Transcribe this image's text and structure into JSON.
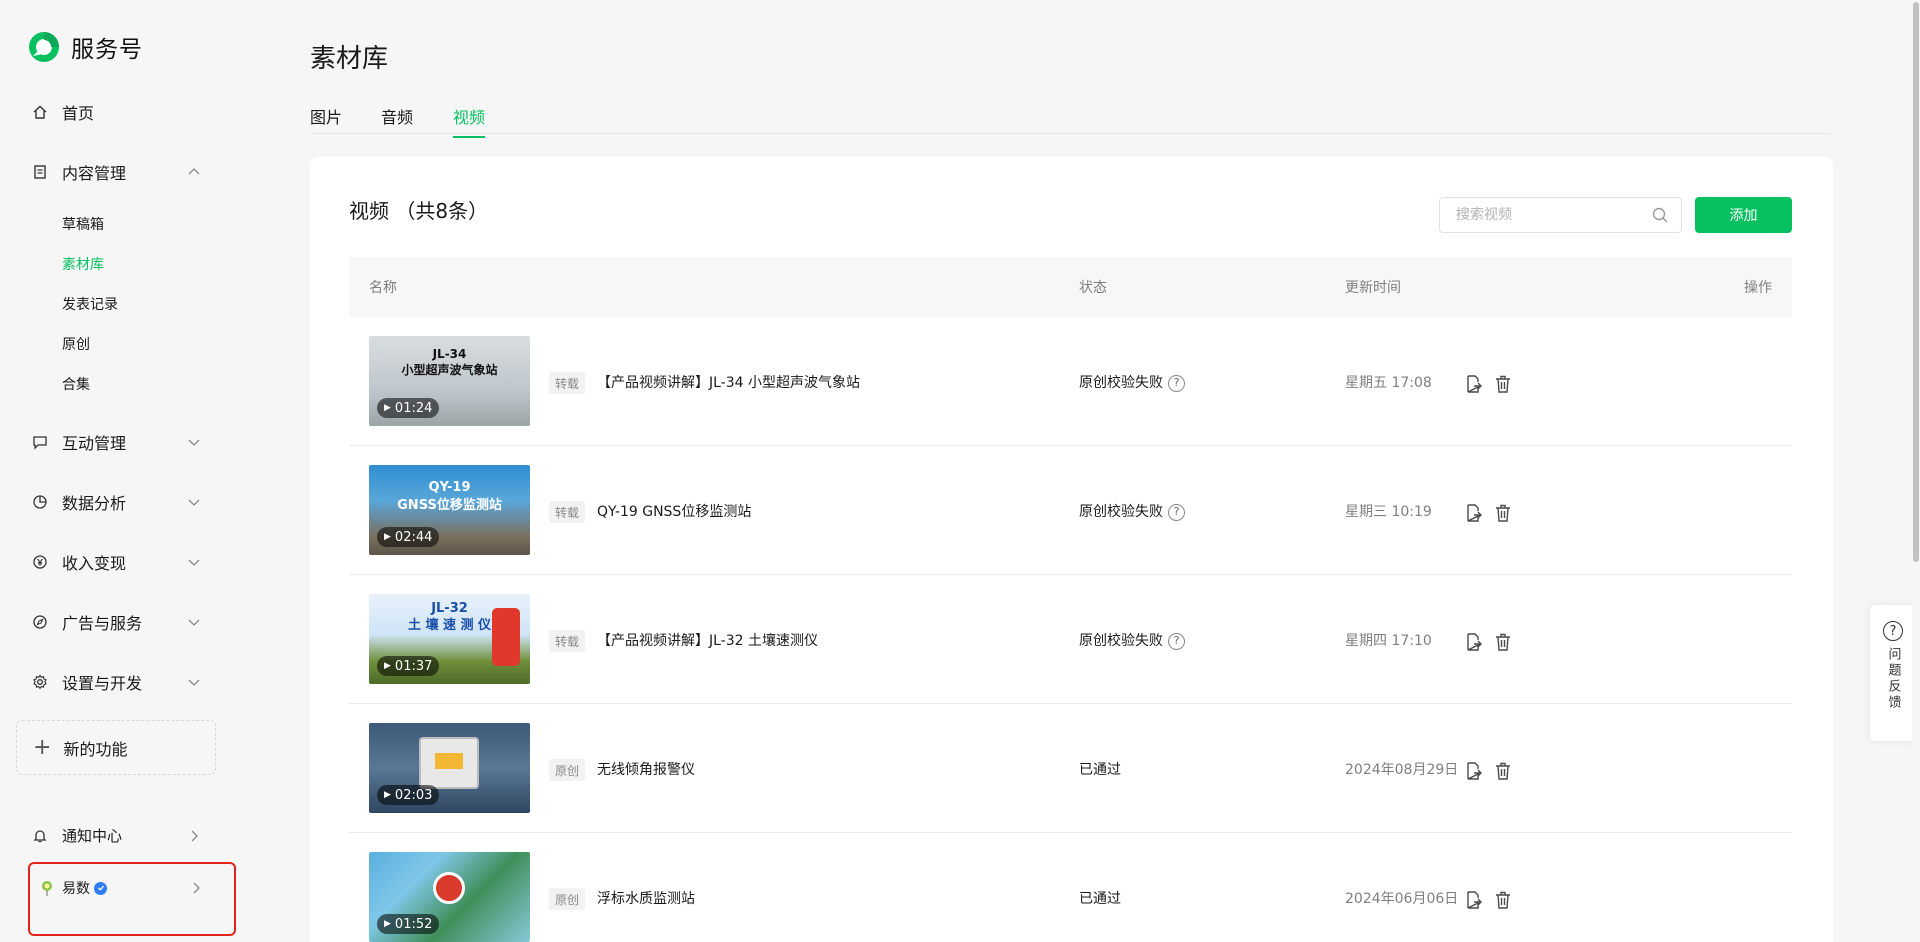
{
  "sidebar": {
    "brand": "服务号",
    "items": [
      {
        "label": "首页",
        "icon": "home-icon"
      },
      {
        "label": "内容管理",
        "icon": "document-icon",
        "expanded": true
      },
      {
        "label": "互动管理",
        "icon": "chat-icon"
      },
      {
        "label": "数据分析",
        "icon": "pie-chart-icon"
      },
      {
        "label": "收入变现",
        "icon": "yuan-icon"
      },
      {
        "label": "广告与服务",
        "icon": "compass-icon"
      },
      {
        "label": "设置与开发",
        "icon": "gear-icon"
      }
    ],
    "content_sub": [
      "草稿箱",
      "素材库",
      "发表记录",
      "原创",
      "合集"
    ],
    "new_feature": "新的功能",
    "notify": "通知中心",
    "account": "易数"
  },
  "page": {
    "title": "素材库",
    "tabs": [
      "图片",
      "音频",
      "视频"
    ],
    "active_tab": "视频"
  },
  "card": {
    "title": "视频  （共8条）",
    "search_placeholder": "搜索视频",
    "add_label": "添加"
  },
  "table": {
    "headers": {
      "name": "名称",
      "status": "状态",
      "time": "更新时间",
      "ops": "操作"
    },
    "rows": [
      {
        "thumb_title": "JL-34\n小型超声波气象站",
        "duration": "01:24",
        "tag": "转载",
        "name": "【产品视频讲解】JL-34 小型超声波气象站",
        "status": "原创校验失败",
        "help": true,
        "time": "星期五 17:08"
      },
      {
        "thumb_title": "QY-19\nGNSS位移监测站",
        "duration": "02:44",
        "tag": "转载",
        "name": "QY-19 GNSS位移监测站",
        "status": "原创校验失败",
        "help": true,
        "time": "星期三 10:19"
      },
      {
        "thumb_title": "JL-32\n土 壤 速 测 仪",
        "duration": "01:37",
        "tag": "转载",
        "name": "【产品视频讲解】JL-32 土壤速测仪",
        "status": "原创校验失败",
        "help": true,
        "time": "星期四 17:10"
      },
      {
        "thumb_title": "",
        "duration": "02:03",
        "tag": "原创",
        "name": "无线倾角报警仪",
        "status": "已通过",
        "help": false,
        "time": "2024年08月29日"
      },
      {
        "thumb_title": "",
        "duration": "01:52",
        "tag": "原创",
        "name": "浮标水质监测站",
        "status": "已通过",
        "help": false,
        "time": "2024年06月06日"
      }
    ]
  },
  "feedback": "问题反馈",
  "colors": {
    "accent": "#07c160",
    "highlight_border": "#e1251b"
  }
}
